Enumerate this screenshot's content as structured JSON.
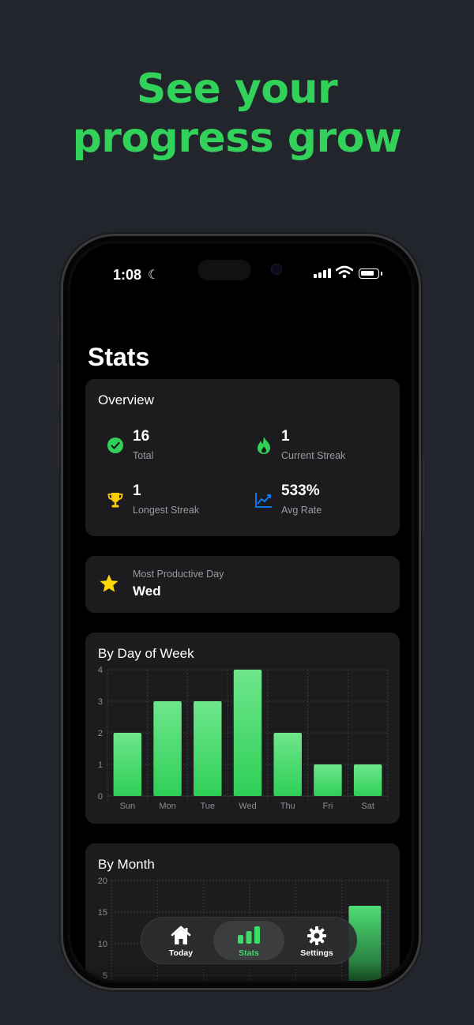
{
  "headline": {
    "line1": "See your",
    "line2": "progress grow"
  },
  "status_bar": {
    "time": "1:08",
    "moon": "☾"
  },
  "page": {
    "title": "Stats"
  },
  "overview": {
    "title": "Overview",
    "items": [
      {
        "value": "16",
        "label": "Total",
        "icon": "check-circle-icon",
        "color": "#30d158"
      },
      {
        "value": "1",
        "label": "Current Streak",
        "icon": "flame-icon",
        "color": "#30d158"
      },
      {
        "value": "1",
        "label": "Longest Streak",
        "icon": "trophy-icon",
        "color": "#ffcc00"
      },
      {
        "value": "533%",
        "label": "Avg Rate",
        "icon": "trend-chart-icon",
        "color": "#0a84ff"
      }
    ]
  },
  "most_productive": {
    "label": "Most Productive Day",
    "value": "Wed",
    "icon": "star-icon",
    "color": "#ffd60a"
  },
  "chart_data": [
    {
      "type": "bar",
      "title": "By Day of Week",
      "categories": [
        "Sun",
        "Mon",
        "Tue",
        "Wed",
        "Thu",
        "Fri",
        "Sat"
      ],
      "values": [
        2,
        3,
        3,
        4,
        2,
        1,
        1
      ],
      "ylim": [
        0,
        4
      ],
      "yticks": [
        0,
        1,
        2,
        3,
        4
      ],
      "grid": true,
      "bar_color": "#30d158"
    },
    {
      "type": "bar",
      "title": "By Month",
      "ylim": [
        0,
        20
      ],
      "yticks": [
        5,
        10,
        15,
        20
      ],
      "values": [
        16
      ],
      "grid": true,
      "bar_color": "#30d158"
    }
  ],
  "tab_bar": {
    "tabs": [
      {
        "label": "Today",
        "icon": "house-icon",
        "active": false
      },
      {
        "label": "Stats",
        "icon": "bar-chart-icon",
        "active": true
      },
      {
        "label": "Settings",
        "icon": "gear-icon",
        "active": false
      }
    ],
    "accent": "#3ddc6a"
  }
}
